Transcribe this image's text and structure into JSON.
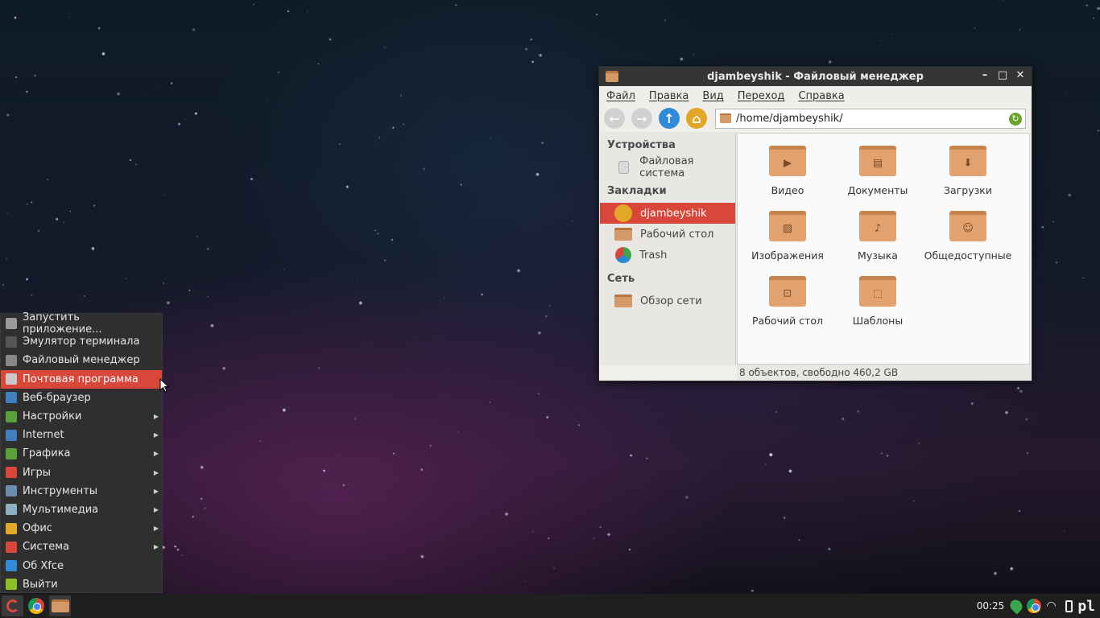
{
  "file_manager": {
    "title": "djambeyshik - Файловый менеджер",
    "menu": [
      "Файл",
      "Правка",
      "Вид",
      "Переход",
      "Справка"
    ],
    "path": "/home/djambeyshik/",
    "sidebar": {
      "devices_header": "Устройства",
      "devices": [
        {
          "label": "Файловая система",
          "icon": "drive-icon"
        }
      ],
      "bookmarks_header": "Закладки",
      "bookmarks": [
        {
          "label": "djambeyshik",
          "icon": "home-icon",
          "active": true
        },
        {
          "label": "Рабочий стол",
          "icon": "folder-icon"
        },
        {
          "label": "Trash",
          "icon": "trash-icon"
        }
      ],
      "network_header": "Сеть",
      "network": [
        {
          "label": "Обзор сети",
          "icon": "network-folder-icon"
        }
      ]
    },
    "files": [
      {
        "label": "Видео",
        "emblem": "▶"
      },
      {
        "label": "Документы",
        "emblem": "▤"
      },
      {
        "label": "Загрузки",
        "emblem": "⬇"
      },
      {
        "label": "Изображения",
        "emblem": "▨"
      },
      {
        "label": "Музыка",
        "emblem": "♪"
      },
      {
        "label": "Общедоступные",
        "emblem": "☺"
      },
      {
        "label": "Рабочий стол",
        "emblem": "⊡"
      },
      {
        "label": "Шаблоны",
        "emblem": "⬚"
      }
    ],
    "status": "8 объектов, свободно 460,2 GB"
  },
  "app_menu": {
    "items": [
      {
        "label": "Запустить приложение...",
        "icon": "gears-icon",
        "color": "#9a9a9a",
        "submenu": false
      },
      {
        "label": "Эмулятор терминала",
        "icon": "terminal-icon",
        "color": "#555555",
        "submenu": false
      },
      {
        "label": "Файловый менеджер",
        "icon": "file-manager-icon",
        "color": "#888888",
        "submenu": false
      },
      {
        "label": "Почтовая программа",
        "icon": "mail-icon",
        "color": "#c9c9c9",
        "submenu": false,
        "highlighted": true
      },
      {
        "label": "Веб-браузер",
        "icon": "browser-icon",
        "color": "#3f7fbf",
        "submenu": false
      },
      {
        "label": "Настройки",
        "icon": "settings-icon",
        "color": "#5aa13a",
        "submenu": true
      },
      {
        "label": "Internet",
        "icon": "globe-icon",
        "color": "#3f7fbf",
        "submenu": true
      },
      {
        "label": "Графика",
        "icon": "graphics-icon",
        "color": "#5aa13a",
        "submenu": true
      },
      {
        "label": "Игры",
        "icon": "gamepad-icon",
        "color": "#d9473a",
        "submenu": true
      },
      {
        "label": "Инструменты",
        "icon": "tools-icon",
        "color": "#6c8fb0",
        "submenu": true
      },
      {
        "label": "Мультимедиа",
        "icon": "music-icon",
        "color": "#8fb0c0",
        "submenu": true
      },
      {
        "label": "Офис",
        "icon": "office-icon",
        "color": "#e3a727",
        "submenu": true
      },
      {
        "label": "Система",
        "icon": "system-icon",
        "color": "#d9473a",
        "submenu": true
      },
      {
        "label": "Об Xfce",
        "icon": "info-icon",
        "color": "#2f8ad8",
        "submenu": false
      },
      {
        "label": "Выйти",
        "icon": "logout-icon",
        "color": "#8cbf26",
        "submenu": false
      }
    ]
  },
  "taskbar": {
    "clock": "00:25",
    "keyboard_layout": "pl"
  },
  "colors": {
    "accent": "#d9473a",
    "folder": "#e2a270",
    "panel": "#1f1f1f"
  }
}
